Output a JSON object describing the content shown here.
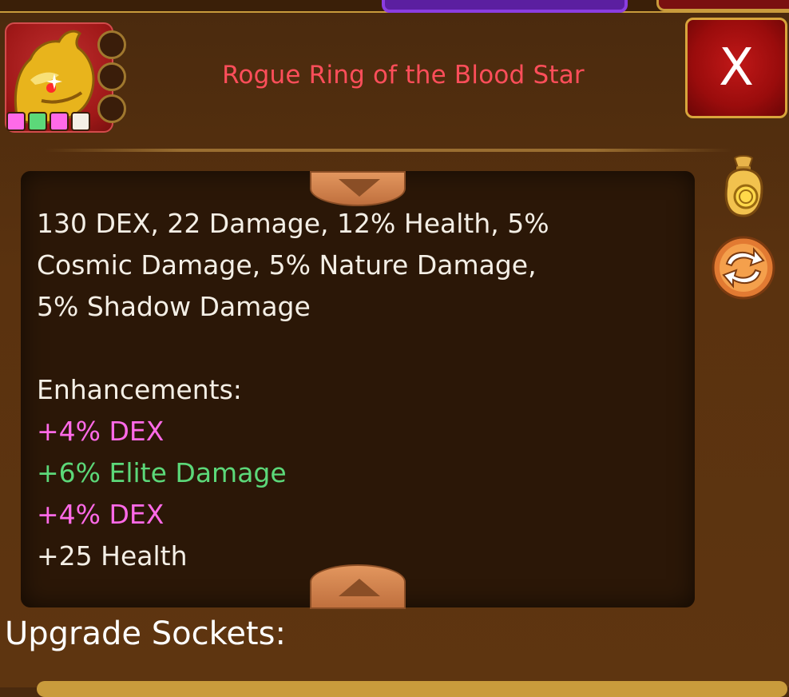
{
  "item": {
    "title": "Rogue Ring of the Blood Star",
    "quality_colors": [
      "#ff6ae8",
      "#5cd879",
      "#ff6ae8",
      "#f4efe6"
    ],
    "gem_slots": 3
  },
  "close_button": {
    "label": "X"
  },
  "description": {
    "stats_lines": [
      "130 DEX, 22 Damage, 12% Health, 5%",
      "Cosmic Damage, 5% Nature Damage,",
      "5% Shadow Damage"
    ],
    "enhancements_header": "Enhancements:",
    "enhancements": [
      {
        "text": "+4% DEX",
        "color": "#ff6ae8"
      },
      {
        "text": "+6% Elite Damage",
        "color": "#5cd879"
      },
      {
        "text": "+4% DEX",
        "color": "#ff6ae8"
      },
      {
        "text": "+25 Health",
        "color": "#f4efe6"
      }
    ]
  },
  "side_actions": {
    "sell_icon": "gold-coin-bag-icon",
    "swap_icon": "swap-arrows-icon"
  },
  "sockets": {
    "label": "Upgrade Sockets:"
  }
}
